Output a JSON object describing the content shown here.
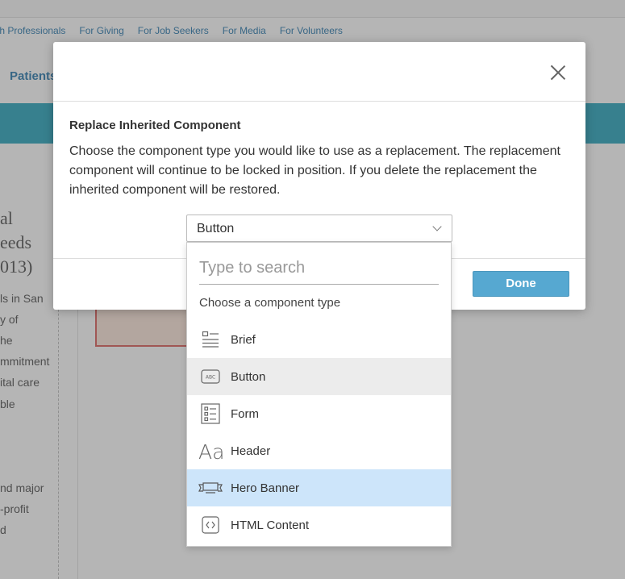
{
  "background": {
    "nav_links": [
      "th Professionals",
      "For Giving",
      "For Job Seekers",
      "For Media",
      "For Volunteers"
    ],
    "patients_label": "Patients",
    "big_text": [
      "al",
      "eeds",
      "013)"
    ],
    "small_text": [
      "ls in San",
      "y of",
      "he",
      "mmitment",
      "ital care",
      "ble",
      "nd major",
      "-profit",
      "d"
    ]
  },
  "modal": {
    "title": "Replace Inherited Component",
    "description": "Choose the component type you would like to use as a replacement. The replacement component will continue to be locked in position. If you delete the replacement the inherited component will be restored.",
    "select_value": "Button",
    "done_label": "Done"
  },
  "dropdown": {
    "search_placeholder": "Type to search",
    "label": "Choose a component type",
    "items": [
      {
        "label": "Brief",
        "icon": "brief-icon"
      },
      {
        "label": "Button",
        "icon": "button-icon"
      },
      {
        "label": "Form",
        "icon": "form-icon"
      },
      {
        "label": "Header",
        "icon": "header-icon"
      },
      {
        "label": "Hero Banner",
        "icon": "hero-banner-icon"
      },
      {
        "label": "HTML Content",
        "icon": "html-content-icon"
      }
    ],
    "selected_item": "Button",
    "hovered_item": "Hero Banner"
  },
  "colors": {
    "accent": "#56a8d1",
    "teal_band": "#1a9fb8",
    "link": "#1b6fa8",
    "hover_row": "#cde5fa",
    "selected_row": "#ececec"
  }
}
